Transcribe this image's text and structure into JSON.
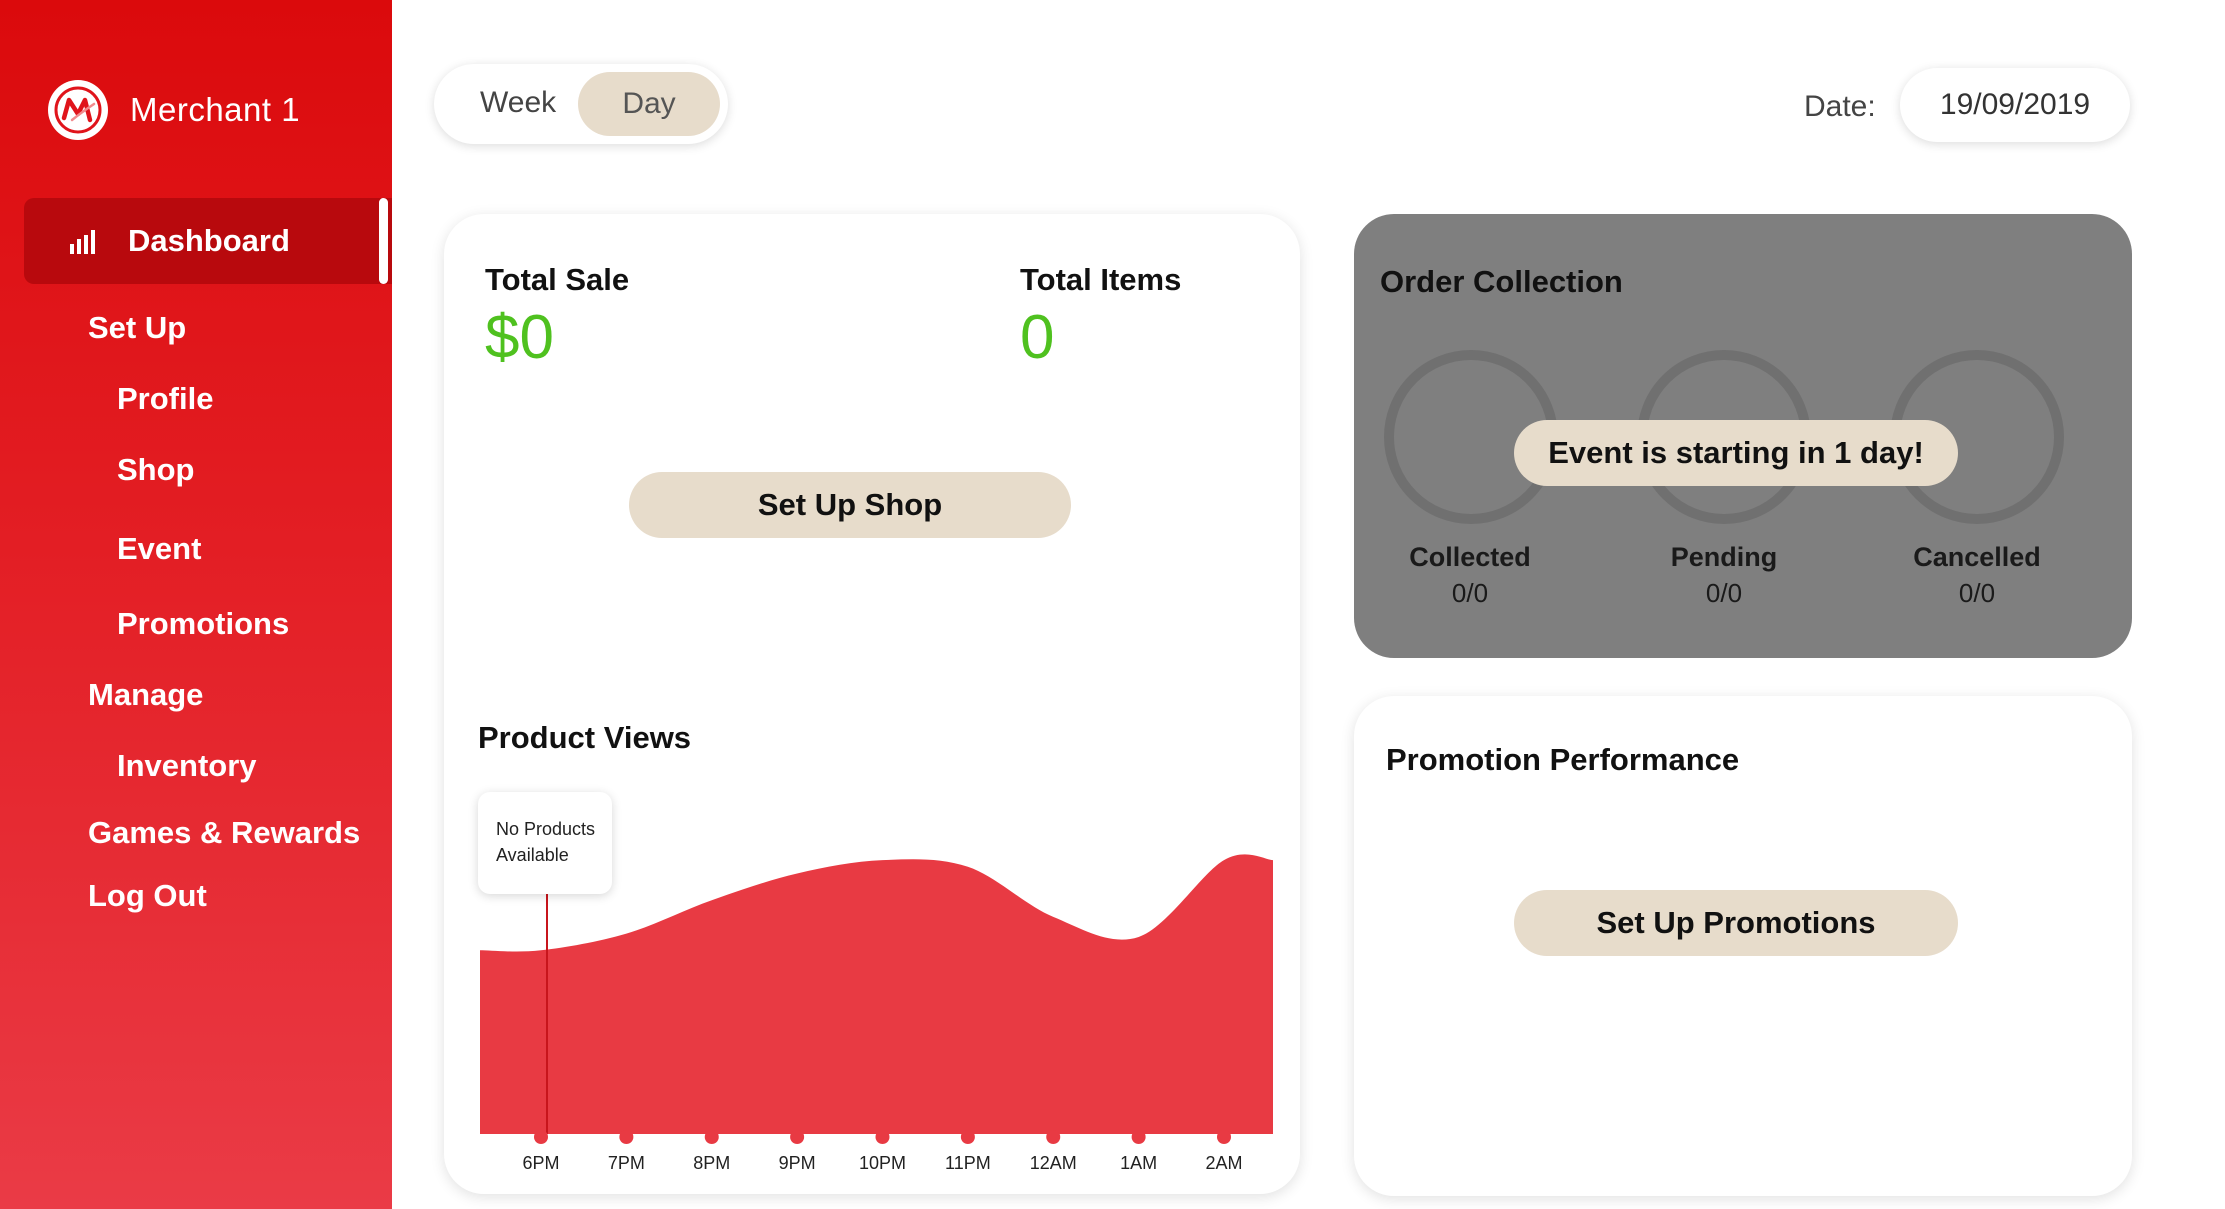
{
  "brand": {
    "name": "Merchant 1",
    "logo_icon": "m-logo-icon"
  },
  "sidebar": {
    "active": {
      "label": "Dashboard",
      "icon": "bar-chart-icon"
    },
    "items": [
      {
        "label": "Set Up",
        "level": 1
      },
      {
        "label": "Profile",
        "level": 2
      },
      {
        "label": "Shop",
        "level": 2
      },
      {
        "label": "Event",
        "level": 2
      },
      {
        "label": "Promotions",
        "level": 2
      },
      {
        "label": "Manage",
        "level": 1
      },
      {
        "label": "Inventory",
        "level": 2
      },
      {
        "label": "Games & Rewards",
        "level": 1
      },
      {
        "label": "Log Out",
        "level": 1
      }
    ]
  },
  "toggle": {
    "week": "Week",
    "day": "Day",
    "selected": "Day"
  },
  "date": {
    "label": "Date:",
    "value": "19/09/2019"
  },
  "sales": {
    "total_sale_label": "Total Sale",
    "total_sale_value": "$0",
    "total_items_label": "Total Items",
    "total_items_value": "0",
    "setup_shop_button": "Set Up Shop"
  },
  "product_views": {
    "title": "Product Views",
    "tooltip": "No Products Available"
  },
  "order_collection": {
    "title": "Order Collection",
    "event_notice": "Event is starting in 1 day!",
    "stats": [
      {
        "label": "Collected",
        "value": "0/0"
      },
      {
        "label": "Pending",
        "value": "0/0"
      },
      {
        "label": "Cancelled",
        "value": "0/0"
      }
    ]
  },
  "promotion": {
    "title": "Promotion Performance",
    "button": "Set Up Promotions"
  },
  "colors": {
    "sidebar_top": "#db0a0c",
    "sidebar_bottom": "#ea3b46",
    "active_nav": "#b8090d",
    "value_green": "#4fc11f",
    "pill_beige": "#e7dccb",
    "chart_red": "#e83a43",
    "order_card_gray": "#7f7f7f"
  },
  "chart_data": {
    "type": "area",
    "categories": [
      "6PM",
      "7PM",
      "8PM",
      "9PM",
      "10PM",
      "11PM",
      "12AM",
      "1AM",
      "2AM"
    ],
    "values": [
      5.5,
      6.0,
      7.0,
      7.8,
      8.2,
      8.0,
      6.5,
      5.9,
      8.2
    ],
    "ylim": [
      0,
      10
    ],
    "title": "Product Views",
    "xlabel": "",
    "ylabel": "",
    "grid": false,
    "legend": "none"
  }
}
